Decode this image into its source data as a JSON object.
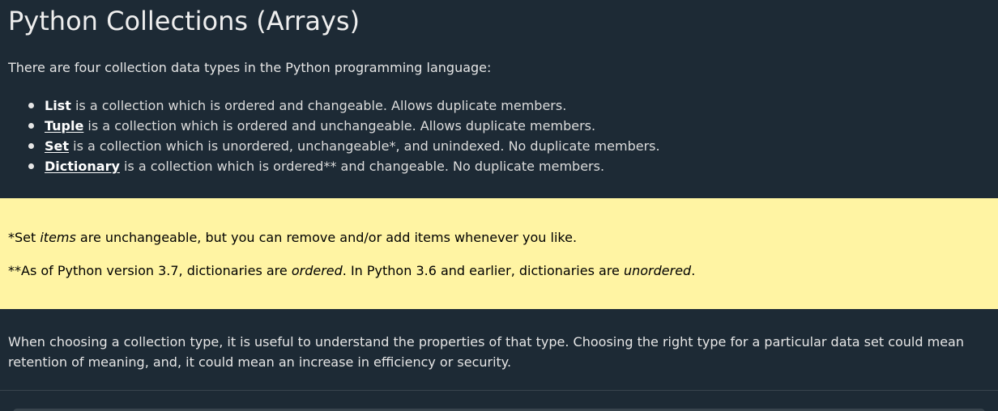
{
  "title": "Python Collections (Arrays)",
  "intro": "There are four collection data types in the Python programming language:",
  "types": [
    {
      "term": "List",
      "linked": false,
      "desc": " is a collection which is ordered and changeable. Allows duplicate members."
    },
    {
      "term": "Tuple",
      "linked": true,
      "desc": " is a collection which is ordered and unchangeable. Allows duplicate members."
    },
    {
      "term": "Set",
      "linked": true,
      "desc": " is a collection which is unordered, unchangeable*, and unindexed. No duplicate members."
    },
    {
      "term": "Dictionary",
      "linked": true,
      "desc": " is a collection which is ordered** and changeable. No duplicate members."
    }
  ],
  "note": {
    "line1": {
      "pre": "*Set ",
      "em": "items",
      "post": " are unchangeable, but you can remove and/or add items whenever you like."
    },
    "line2": {
      "pre": "**As of Python version 3.7, dictionaries are ",
      "em1": "ordered",
      "mid": ". In Python 3.6 and earlier, dictionaries are ",
      "em2": "unordered",
      "post": "."
    }
  },
  "choose": "When choosing a collection type, it is useful to understand the properties of that type. Choosing the right type for a particular data set could mean retention of meaning, and, it could mean an increase in efficiency or security.",
  "colors": {
    "background": "#1d2a35",
    "note_background": "#fff4a3"
  }
}
